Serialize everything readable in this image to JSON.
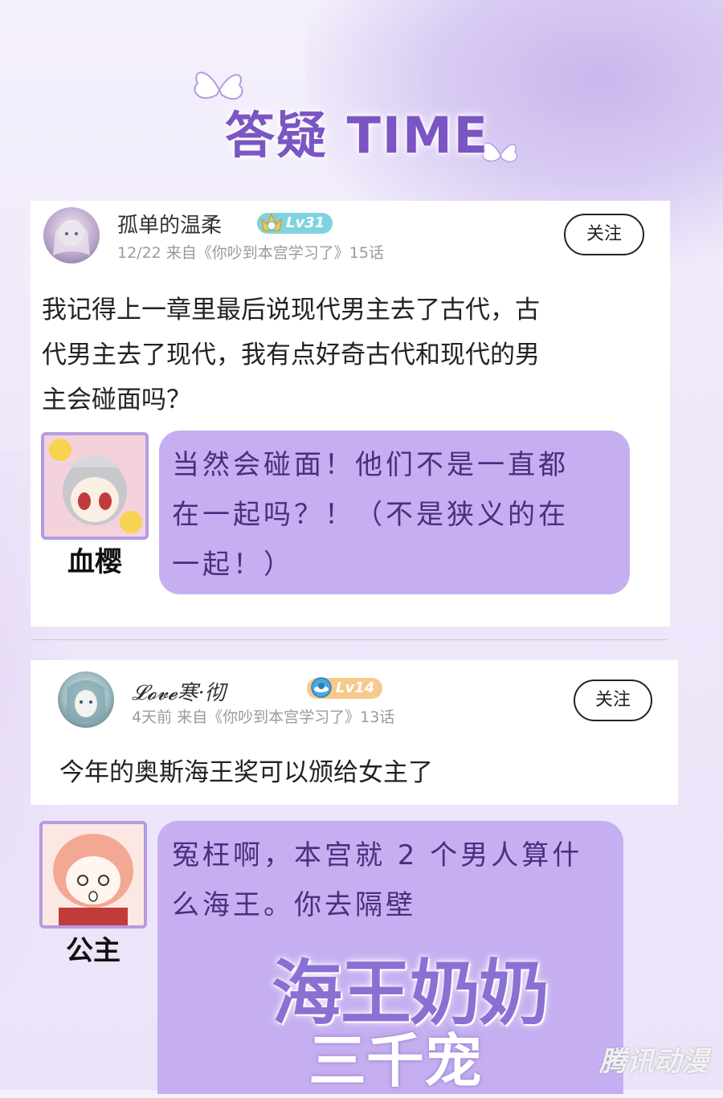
{
  "header": {
    "title": "答疑 TIME"
  },
  "posts": [
    {
      "username": "孤单的温柔",
      "level": "Lv31",
      "level_color": "#5fc6d8",
      "meta": "12/22  来自《你吵到本宫学习了》15话",
      "follow_label": "关注",
      "comment": [
        "我记得上一章里最后说现代男主去了古代，古",
        "代男主去了现代，我有点好奇古代和现代的男",
        "主会碰面吗？"
      ],
      "reply": {
        "name": "血樱",
        "text": [
          "当然会碰面！他们不是一直都",
          "在一起吗？！（不是狭义的在",
          "一起！）"
        ]
      }
    },
    {
      "username": "𝓛𝓸𝓿𝓮寒·彻",
      "level": "Lv14",
      "level_color": "#f2b866",
      "meta": "4天前  来自《你吵到本宫学习了》13话",
      "follow_label": "关注",
      "comment": [
        "今年的奥斯海王奖可以颁给女主了"
      ],
      "reply": {
        "name": "公主",
        "text": [
          "冤枉啊，本宫就 2 个男人算什",
          "么海王。你去隔壁"
        ],
        "logo_line1": "海王奶奶",
        "logo_line2": "三千宠"
      }
    }
  ],
  "watermark": "腾讯动漫",
  "colors": {
    "accent": "#7b55c3",
    "bubble": "#c5aff0"
  }
}
